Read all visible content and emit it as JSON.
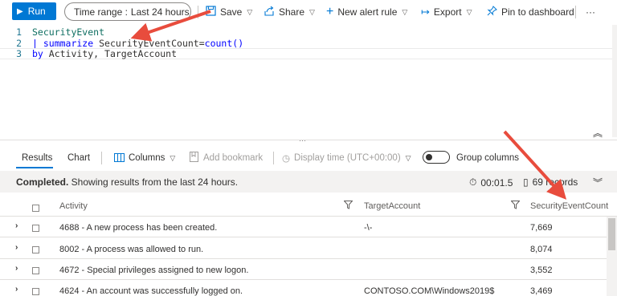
{
  "toolbar": {
    "run_label": "Run",
    "time_range_label": "Time range :",
    "time_range_value": "Last 24 hours",
    "save_label": "Save",
    "share_label": "Share",
    "new_alert_label": "New alert rule",
    "export_label": "Export",
    "pin_label": "Pin to dashboard",
    "more_label": "···"
  },
  "editor": {
    "lines": [
      {
        "num": "1",
        "a": "SecurityEvent",
        "b": "",
        "c": ""
      },
      {
        "num": "2",
        "a": "| summarize",
        "b": " SecurityEventCount=",
        "c": "count()"
      },
      {
        "num": "3",
        "a": "by",
        "b": " Activity, TargetAccount",
        "c": ""
      }
    ]
  },
  "results": {
    "tab_results": "Results",
    "tab_chart": "Chart",
    "columns_label": "Columns",
    "add_bookmark_label": "Add bookmark",
    "display_time_label": "Display time (UTC+00:00)",
    "group_columns_label": "Group columns",
    "status_bold": "Completed.",
    "status_rest": " Showing results from the last 24 hours.",
    "duration": "00:01.5",
    "records": "69 records"
  },
  "table": {
    "headers": [
      "Activity",
      "TargetAccount",
      "SecurityEventCount"
    ],
    "rows": [
      {
        "activity": "4688 - A new process has been created.",
        "target": "-\\-",
        "count": "7,669"
      },
      {
        "activity": "8002 - A process was allowed to run.",
        "target": "",
        "count": "8,074"
      },
      {
        "activity": "4672 - Special privileges assigned to new logon.",
        "target": "",
        "count": "3,552"
      },
      {
        "activity": "4624 - An account was successfully logged on.",
        "target": "CONTOSO.COM\\Windows2019$",
        "count": "3,469"
      }
    ]
  },
  "colors": {
    "accent": "#0078d4",
    "annotation_arrow": "#e84c3d"
  }
}
